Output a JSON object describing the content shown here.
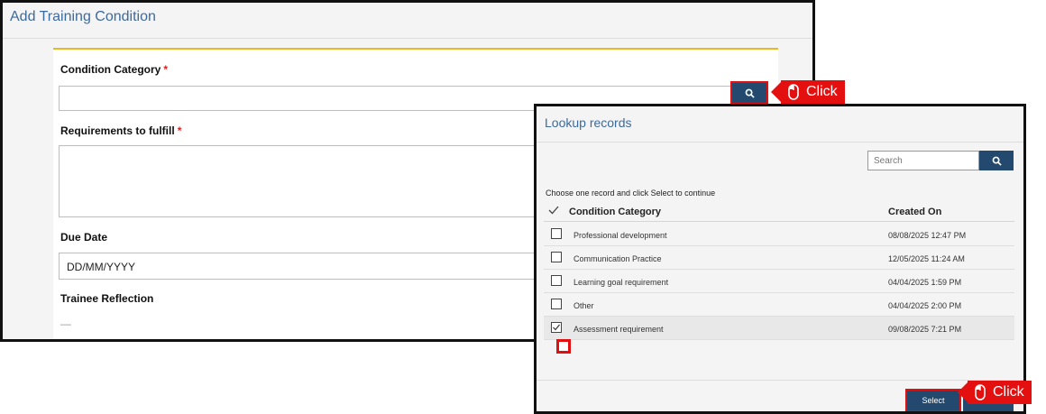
{
  "form": {
    "title": "Add Training Condition",
    "condition_category_label": "Condition Category",
    "required_mark": "*",
    "requirements_label": "Requirements to fulfill",
    "due_date_label": "Due Date",
    "due_date_placeholder": "DD/MM/YYYY",
    "trainee_reflection_label": "Trainee Reflection",
    "trainee_reflection_value": "—"
  },
  "callouts": {
    "search_click": "Click",
    "select_click": "Click"
  },
  "lookup": {
    "title": "Lookup records",
    "search_placeholder": "Search",
    "instruction": "Choose one record and click Select to continue",
    "col_category": "Condition Category",
    "col_created": "Created On",
    "rows": [
      {
        "category": "Professional development",
        "created": "08/08/2025 12:47 PM",
        "checked": false
      },
      {
        "category": "Communication Practice",
        "created": "12/05/2025 11:24 AM",
        "checked": false
      },
      {
        "category": "Learning goal requirement",
        "created": "04/04/2025 1:59 PM",
        "checked": false
      },
      {
        "category": "Other",
        "created": "04/04/2025 2:00 PM",
        "checked": false
      },
      {
        "category": "Assessment requirement",
        "created": "09/08/2025 7:21 PM",
        "checked": true
      }
    ],
    "select_label": "Select"
  },
  "colors": {
    "accent_blue": "#234a6e",
    "title_blue": "#3d6a9e",
    "highlight_red": "#e41010",
    "panel_gold": "#e9b827"
  }
}
